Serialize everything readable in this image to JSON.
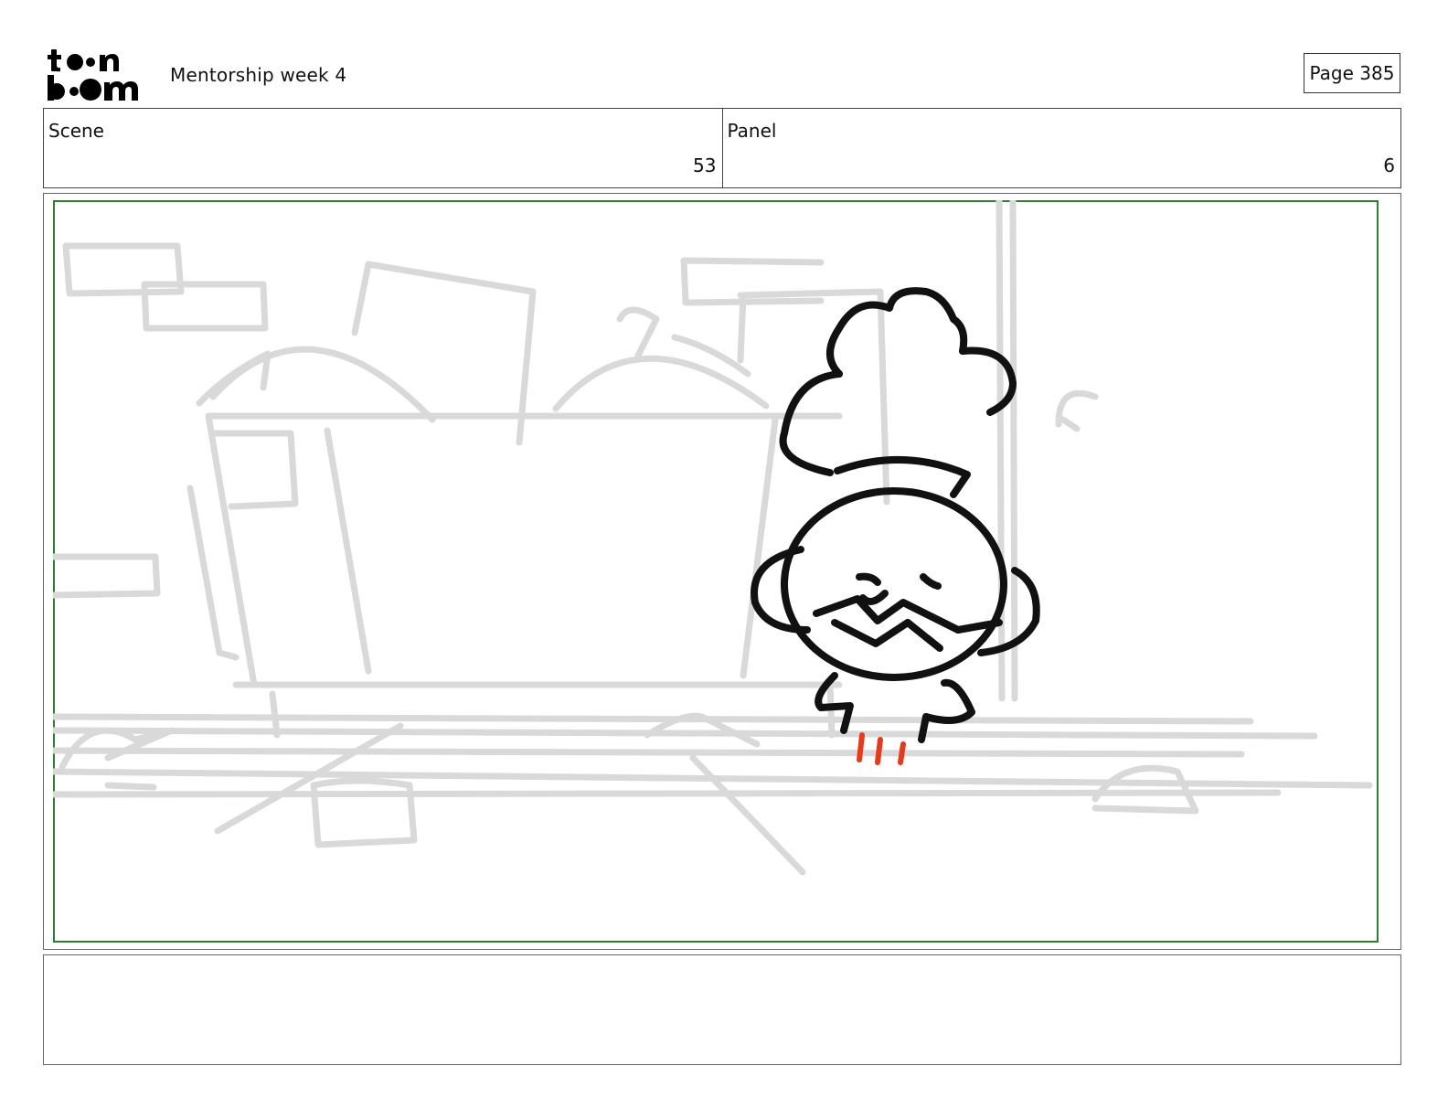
{
  "header": {
    "logo_text": "toon boom",
    "title": "Mentorship week 4",
    "page_label": "Page 385"
  },
  "info": {
    "scene_label": "Scene",
    "scene_value": "53",
    "panel_label": "Panel",
    "panel_value": "6"
  },
  "panel": {
    "frame_color": "#2e7d32",
    "sketch_color": "#d8d8d8",
    "ink_color": "#111111",
    "accent_color": "#e53a1b",
    "illustration": "character-sketch"
  },
  "notes": {
    "text": ""
  }
}
